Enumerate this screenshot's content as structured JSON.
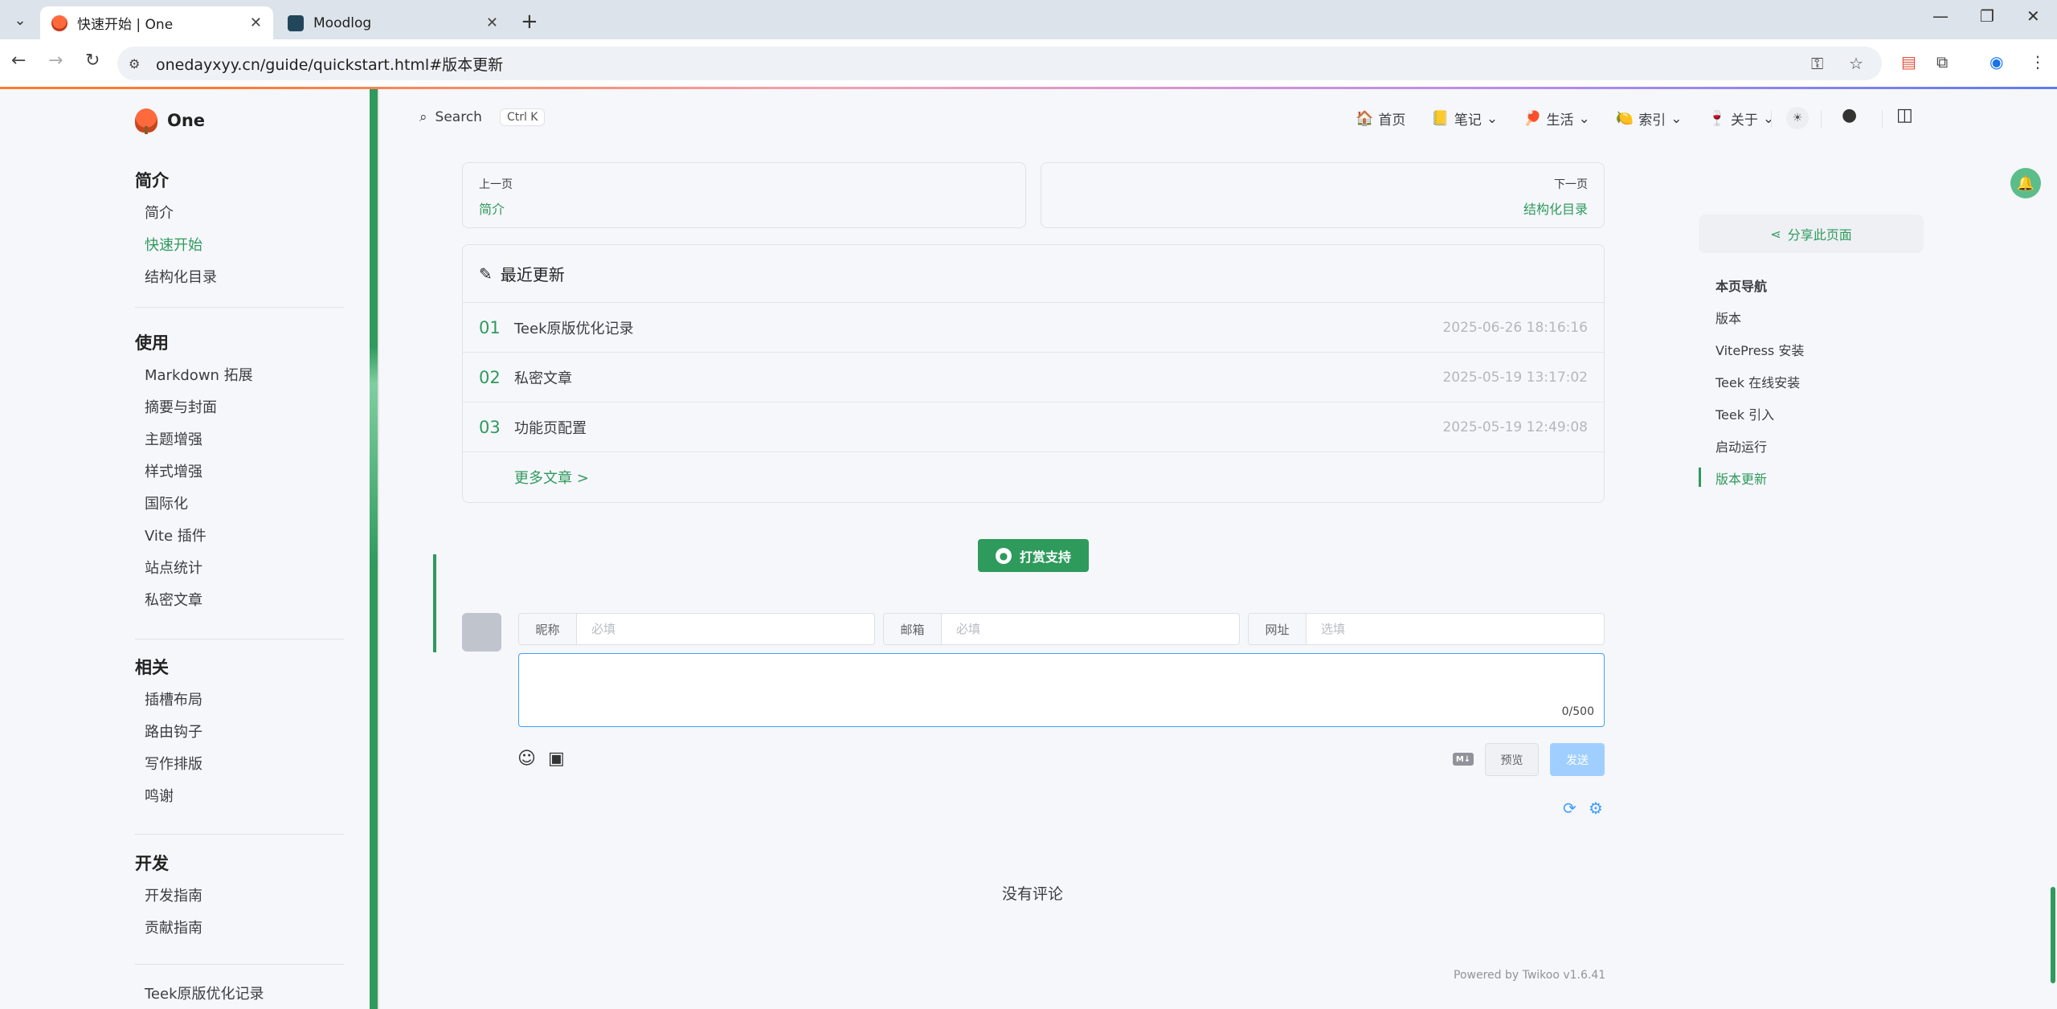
{
  "browser": {
    "tabs": [
      {
        "title": "快速开始 | One",
        "active": true
      },
      {
        "title": "Moodlog",
        "active": false
      }
    ],
    "url": "onedayxyy.cn/guide/quickstart.html#版本更新"
  },
  "site": {
    "name": "One",
    "search_label": "Search",
    "search_kbd": "Ctrl K",
    "nav": [
      {
        "emoji": "🏠",
        "label": "首页",
        "dropdown": false
      },
      {
        "emoji": "📒",
        "label": "笔记",
        "dropdown": true
      },
      {
        "emoji": "🏓",
        "label": "生活",
        "dropdown": true
      },
      {
        "emoji": "🍋",
        "label": "索引",
        "dropdown": true
      },
      {
        "emoji": "🍷",
        "label": "关于",
        "dropdown": true
      }
    ]
  },
  "sidebar": {
    "groups": [
      {
        "title": "简介",
        "items": [
          "简介",
          "快速开始",
          "结构化目录"
        ]
      },
      {
        "title": "使用",
        "items": [
          "Markdown 拓展",
          "摘要与封面",
          "主题增强",
          "样式增强",
          "国际化",
          "Vite 插件",
          "站点统计",
          "私密文章"
        ]
      },
      {
        "title": "相关",
        "items": [
          "插槽布局",
          "路由钩子",
          "写作排版",
          "鸣谢"
        ]
      },
      {
        "title": "开发",
        "items": [
          "开发指南",
          "贡献指南"
        ]
      }
    ],
    "active_item": "快速开始",
    "bottom_item": "Teek原版优化记录"
  },
  "pager": {
    "prev_label": "上一页",
    "prev_link": "简介",
    "next_label": "下一页",
    "next_link": "结构化目录"
  },
  "recent": {
    "title": "最近更新",
    "items": [
      {
        "num": "01",
        "title": "Teek原版优化记录",
        "date": "2025-06-26 18:16:16"
      },
      {
        "num": "02",
        "title": "私密文章",
        "date": "2025-05-19 13:17:02"
      },
      {
        "num": "03",
        "title": "功能页配置",
        "date": "2025-05-19 12:49:08"
      }
    ],
    "more": "更多文章 >"
  },
  "donate_label": "打赏支持",
  "comment": {
    "nick_label": "昵称",
    "nick_placeholder": "必填",
    "mail_label": "邮箱",
    "mail_placeholder": "必填",
    "url_label": "网址",
    "url_placeholder": "选填",
    "count": "0/500",
    "md_badge": "M↓",
    "preview": "预览",
    "send": "发送",
    "no_comment": "没有评论",
    "powered": "Powered by Twikoo v1.6.41"
  },
  "aside": {
    "share": "分享此页面",
    "toc_title": "本页导航",
    "toc": [
      "版本",
      "VitePress 安装",
      "Teek 在线安装",
      "Teek 引入",
      "启动运行",
      "版本更新"
    ],
    "toc_active": "版本更新"
  },
  "colors": {
    "brand": "#2e9a5c",
    "link": "#409eff"
  }
}
